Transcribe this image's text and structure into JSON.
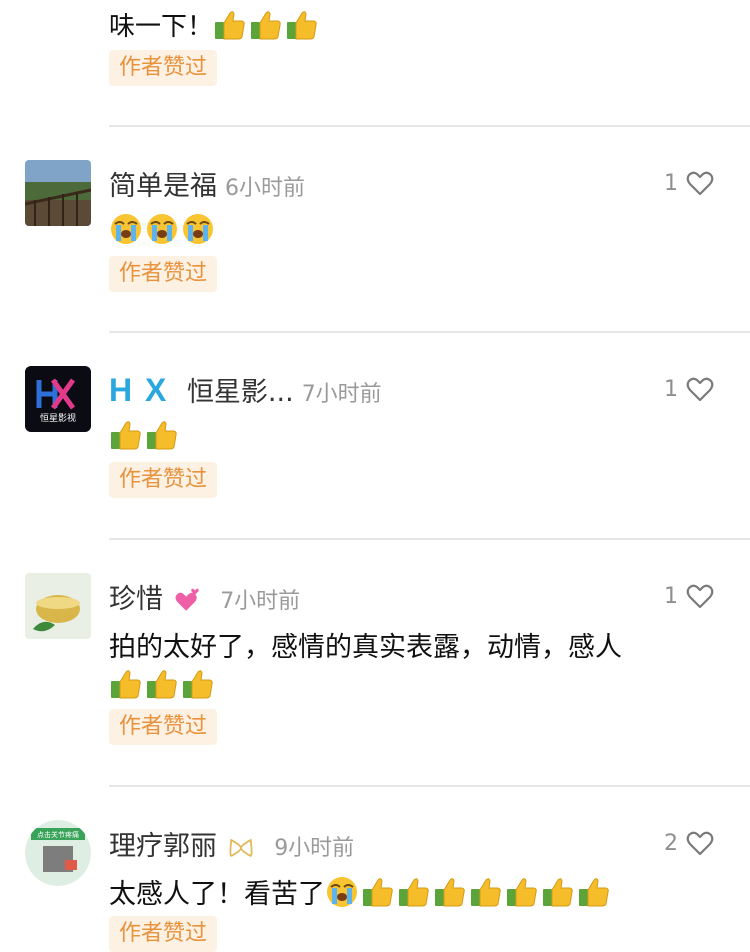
{
  "top_partial": {
    "text": "味一下！",
    "emojis": [
      "thumbs-up",
      "thumbs-up",
      "thumbs-up"
    ],
    "badge": "作者赞过"
  },
  "comments": [
    {
      "name": "简单是福",
      "time": "6小时前",
      "likes": "1",
      "text": "",
      "emojis": [
        "crying-face",
        "crying-face",
        "crying-face"
      ],
      "badge": "作者赞过"
    },
    {
      "name_logo": "H X",
      "name": "恒星影...",
      "time": "7小时前",
      "likes": "1",
      "text": "",
      "emojis": [
        "thumbs-up",
        "thumbs-up"
      ],
      "badge": "作者赞过"
    },
    {
      "name": "珍惜",
      "name_badge": "revolving-hearts",
      "time": "7小时前",
      "likes": "1",
      "text": "拍的太好了，感情的真实表露，动情，感人",
      "emojis": [
        "thumbs-up",
        "thumbs-up",
        "thumbs-up"
      ],
      "badge": "作者赞过"
    },
    {
      "name": "理疗郭丽",
      "name_badge": "ribbon",
      "time": "9小时前",
      "likes": "2",
      "text": "太感人了！看苦了",
      "emojis": [
        "crying-face",
        "thumbs-up",
        "thumbs-up",
        "thumbs-up",
        "thumbs-up",
        "thumbs-up",
        "thumbs-up",
        "thumbs-up"
      ],
      "badge": "作者赞过"
    }
  ],
  "avatar_texts": {
    "hx_logo_caption": "恒星影视",
    "liliao_caption": "点击关节疼痛"
  }
}
